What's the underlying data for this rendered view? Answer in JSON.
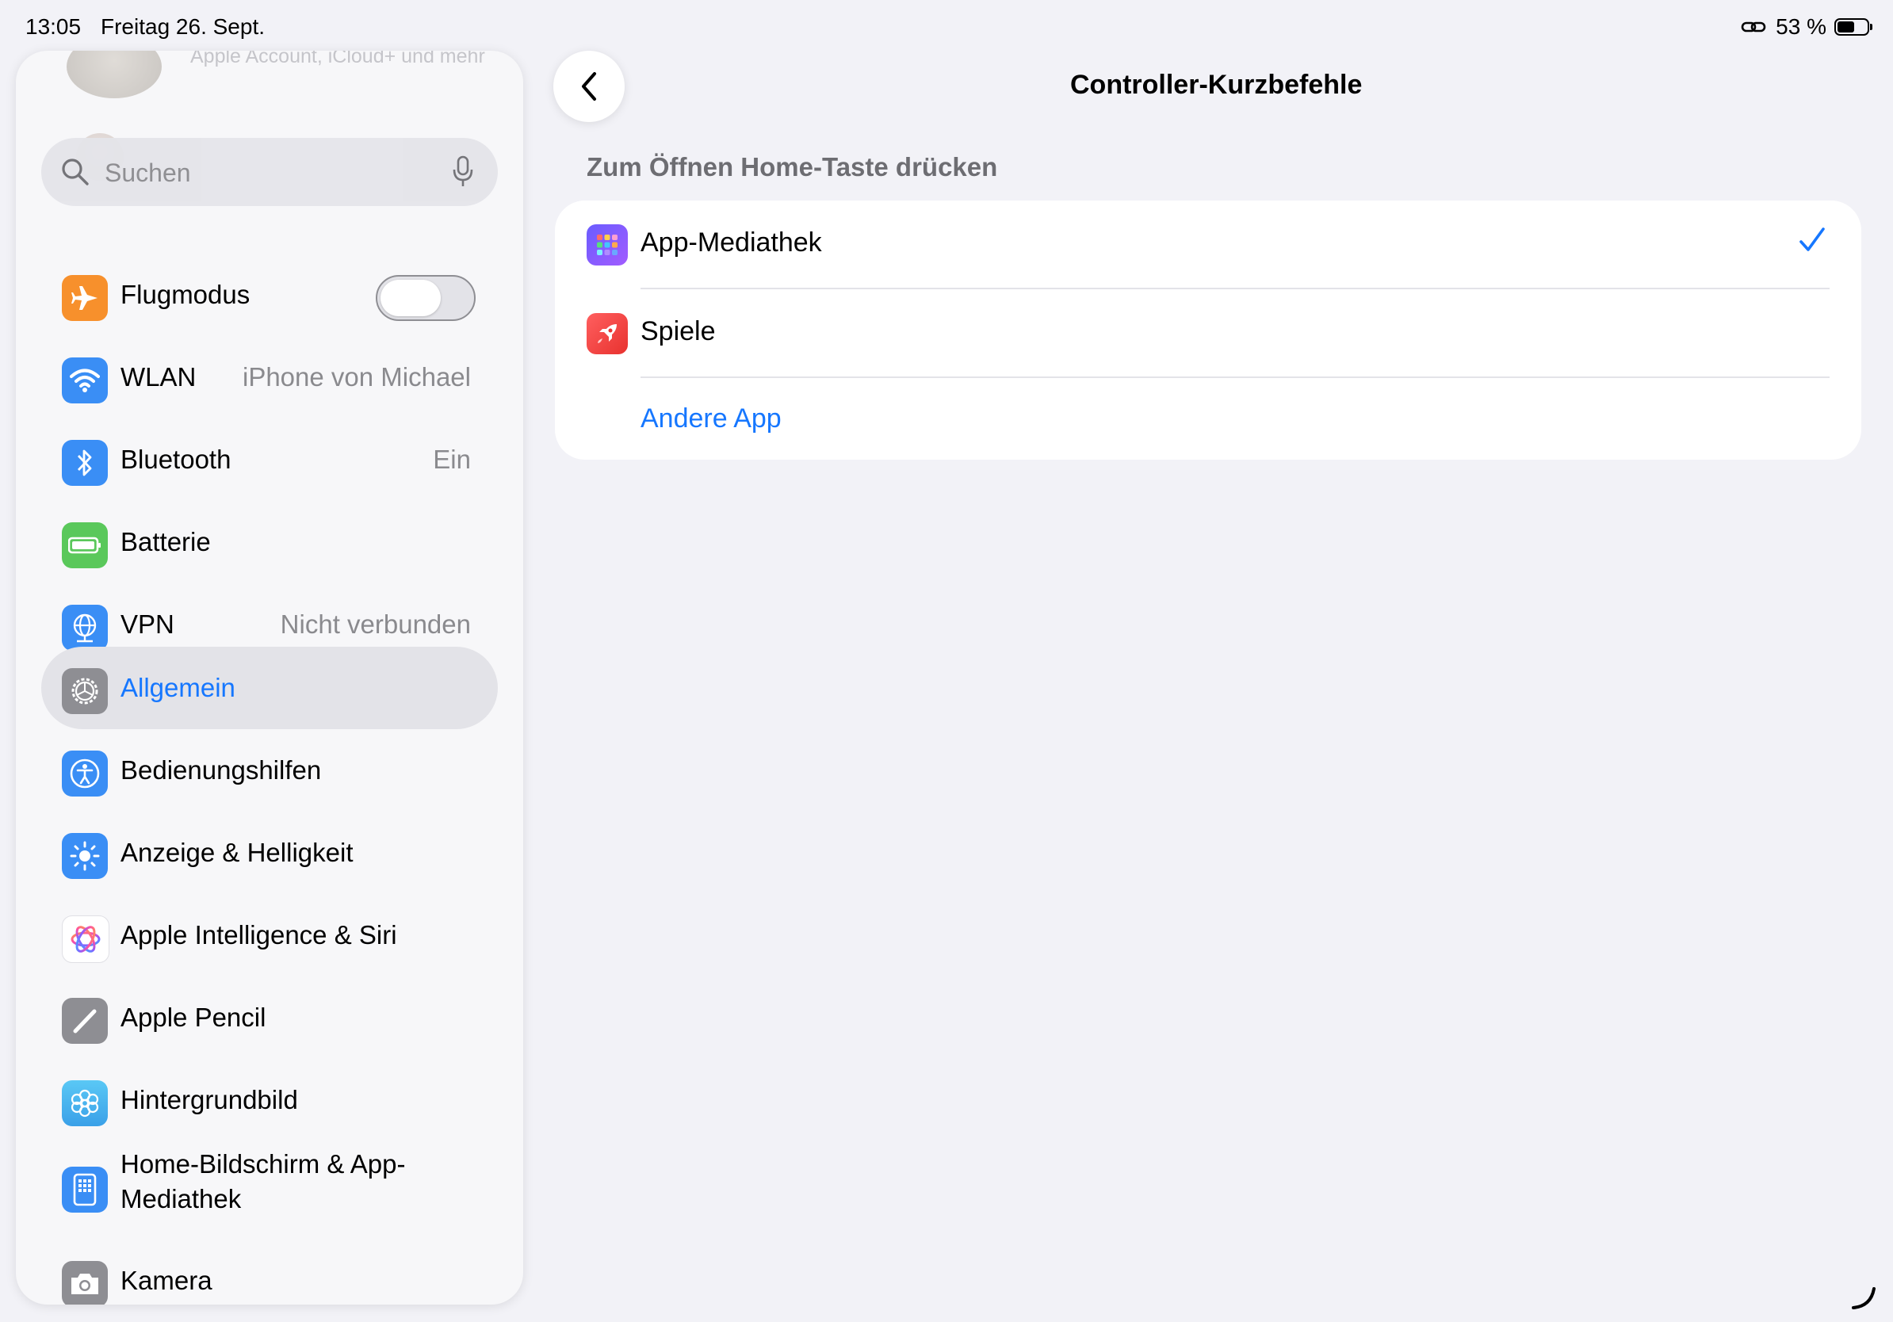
{
  "status_bar": {
    "time": "13:05",
    "date": "Freitag 26. Sept.",
    "battery": "53 %",
    "battery_level": 0.53
  },
  "sidebar": {
    "profile_subtitle": "Apple Account, iCloud+ und mehr",
    "search": {
      "placeholder": "Suchen"
    },
    "items": [
      {
        "label": "Flugmodus",
        "toggle_on": false,
        "icon": "airplane-icon",
        "color": "#f7902c"
      },
      {
        "label": "WLAN",
        "value": "iPhone von Michael",
        "icon": "wifi-icon",
        "color": "#3a8ef5"
      },
      {
        "label": "Bluetooth",
        "value": "Ein",
        "icon": "bluetooth-icon",
        "color": "#3a8ef5"
      },
      {
        "label": "Batterie",
        "icon": "battery-icon",
        "color": "#5ac85b"
      },
      {
        "label": "VPN",
        "value": "Nicht verbunden",
        "icon": "globe-icon",
        "color": "#3a8ef5"
      },
      {
        "label": "Allgemein",
        "selected": true,
        "icon": "gear-icon",
        "color": "#8e8e93"
      },
      {
        "label": "Bedienungshilfen",
        "icon": "accessibility-icon",
        "color": "#3a8ef5"
      },
      {
        "label": "Anzeige & Helligkeit",
        "icon": "sun-icon",
        "color": "#3a8ef5"
      },
      {
        "label": "Apple Intelligence & Siri",
        "icon": "apple-intelligence-icon",
        "color": "#ffffff"
      },
      {
        "label": "Apple Pencil",
        "icon": "pencil-icon",
        "color": "#8e8e93"
      },
      {
        "label": "Hintergrundbild",
        "icon": "flower-icon",
        "color": "#4bb6e8"
      },
      {
        "label": "Home-Bildschirm & App-Mediathek",
        "icon": "home-screen-icon",
        "color": "#3a8ef5"
      },
      {
        "label": "Kamera",
        "icon": "camera-icon",
        "color": "#8e8e93"
      }
    ]
  },
  "main": {
    "title": "Controller-Kurzbefehle",
    "section_header": "Zum Öffnen Home-Taste drücken",
    "options": [
      {
        "label": "App-Mediathek",
        "checked": true,
        "icon": "app-library-icon"
      },
      {
        "label": "Spiele",
        "checked": false,
        "icon": "games-rocket-icon"
      }
    ],
    "other_app_link": "Andere App",
    "accent_color": "#1677ff"
  }
}
